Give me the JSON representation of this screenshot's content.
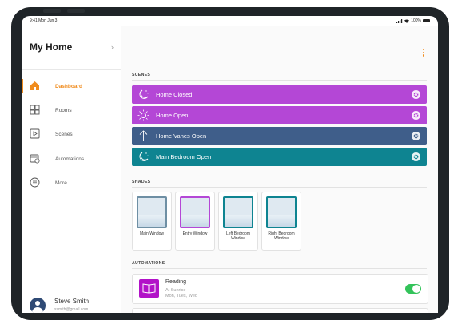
{
  "status": {
    "time": "9:41  Mon Jun 3",
    "battery": "100%"
  },
  "home": {
    "title": "My Home"
  },
  "nav": [
    {
      "label": "Dashboard",
      "icon": "house-icon",
      "active": true
    },
    {
      "label": "Rooms",
      "icon": "grid-icon"
    },
    {
      "label": "Scenes",
      "icon": "play-square-icon"
    },
    {
      "label": "Automations",
      "icon": "calendar-clock-icon"
    },
    {
      "label": "More",
      "icon": "more-circle-icon"
    }
  ],
  "user": {
    "name": "Steve Smith",
    "email": "ssmith@gmail.com"
  },
  "sections": {
    "scenes": "SCENES",
    "shades": "SHADES",
    "automations": "AUTOMATIONS"
  },
  "scenes": [
    {
      "label": "Home Closed",
      "icon": "moon-stars-icon",
      "color": "#b447d6"
    },
    {
      "label": "Home Open",
      "icon": "sun-icon",
      "color": "#b447d6"
    },
    {
      "label": "Home Vanes Open",
      "icon": "arrow-up-icon",
      "color": "#3f5e8a"
    },
    {
      "label": "Main Bedroom Open",
      "icon": "moon-stars-icon",
      "color": "#0e8491"
    }
  ],
  "shades": [
    {
      "label": "Main Window",
      "color": "#6e8fa4"
    },
    {
      "label": "Entry Window",
      "color": "#b447d6"
    },
    {
      "label": "Left Bedroom Window",
      "color": "#0e8491"
    },
    {
      "label": "Right Bedroom Window",
      "color": "#0e8491"
    }
  ],
  "automations": [
    {
      "title": "Reading",
      "time": "At Sunrise",
      "days": "Mon, Tues, Wed",
      "enabled": true,
      "color": "#b212c8"
    }
  ],
  "colors": {
    "accent": "#f08c1e",
    "toggle_on": "#33c35a"
  }
}
